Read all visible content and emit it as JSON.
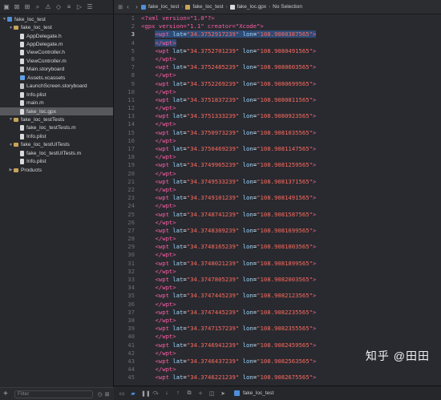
{
  "colors": {
    "accent": "#4a90e2",
    "selection": "#2e4b76",
    "tag": "#fc5fa3",
    "attr": "#9ddbff",
    "string": "#fc6a5d"
  },
  "navigator": {
    "items": [
      {
        "label": "fake_loc_test",
        "level": 0,
        "kind": "project",
        "disclosure": "▼",
        "selected": false
      },
      {
        "label": "fake_loc_test",
        "level": 1,
        "kind": "folder",
        "disclosure": "▼",
        "selected": false
      },
      {
        "label": "AppDelegate.h",
        "level": 2,
        "kind": "file",
        "disclosure": "",
        "selected": false
      },
      {
        "label": "AppDelegate.m",
        "level": 2,
        "kind": "file",
        "disclosure": "",
        "selected": false
      },
      {
        "label": "ViewController.h",
        "level": 2,
        "kind": "file",
        "disclosure": "",
        "selected": false
      },
      {
        "label": "ViewController.m",
        "level": 2,
        "kind": "file",
        "disclosure": "",
        "selected": false
      },
      {
        "label": "Main.storyboard",
        "level": 2,
        "kind": "storyboard",
        "disclosure": "",
        "selected": false
      },
      {
        "label": "Assets.xcassets",
        "level": 2,
        "kind": "asset",
        "disclosure": "",
        "selected": false
      },
      {
        "label": "LaunchScreen.storyboard",
        "level": 2,
        "kind": "storyboard",
        "disclosure": "",
        "selected": false
      },
      {
        "label": "Info.plist",
        "level": 2,
        "kind": "file",
        "disclosure": "",
        "selected": false
      },
      {
        "label": "main.m",
        "level": 2,
        "kind": "file",
        "disclosure": "",
        "selected": false
      },
      {
        "label": "fake_loc.gpx",
        "level": 2,
        "kind": "file",
        "disclosure": "",
        "selected": true
      },
      {
        "label": "fake_loc_testTests",
        "level": 1,
        "kind": "folder",
        "disclosure": "▼",
        "selected": false
      },
      {
        "label": "fake_loc_testTests.m",
        "level": 2,
        "kind": "file",
        "disclosure": "",
        "selected": false
      },
      {
        "label": "Info.plist",
        "level": 2,
        "kind": "file",
        "disclosure": "",
        "selected": false
      },
      {
        "label": "fake_loc_testUITests",
        "level": 1,
        "kind": "folder",
        "disclosure": "▼",
        "selected": false
      },
      {
        "label": "fake_loc_testUITests.m",
        "level": 2,
        "kind": "file",
        "disclosure": "",
        "selected": false
      },
      {
        "label": "Info.plist",
        "level": 2,
        "kind": "file",
        "disclosure": "",
        "selected": false
      },
      {
        "label": "Products",
        "level": 1,
        "kind": "folder",
        "disclosure": "▶",
        "selected": false
      }
    ],
    "filter_placeholder": "Filter",
    "add_label": "+"
  },
  "jump_bar": {
    "crumbs": [
      "fake_loc_test",
      "fake_loc_test",
      "fake_loc.gpx",
      "No Selection"
    ]
  },
  "editor": {
    "lines": [
      {
        "n": "1",
        "indent": "",
        "kind": "xmldecl",
        "text": "<?xml version=\"1.0\"?>",
        "highlight": false
      },
      {
        "n": "2",
        "indent": "",
        "kind": "gpx",
        "text": "<gpx version=\"1.1\" creator=\"Xcode\">",
        "highlight": false
      },
      {
        "n": "3",
        "indent": "    ",
        "kind": "wpt",
        "lat": "34.3752917239",
        "lon": "108.9080387565",
        "highlight": true
      },
      {
        "n": "4",
        "indent": "    ",
        "kind": "close",
        "text": "</wpt>",
        "highlight": true
      },
      {
        "n": "5",
        "indent": "    ",
        "kind": "wpt",
        "lat": "34.3752701239",
        "lon": "108.9080491565",
        "highlight": false
      },
      {
        "n": "6",
        "indent": "    ",
        "kind": "close",
        "text": "</wpt>",
        "highlight": false
      },
      {
        "n": "7",
        "indent": "    ",
        "kind": "wpt",
        "lat": "34.3752485239",
        "lon": "108.9080603565",
        "highlight": false
      },
      {
        "n": "8",
        "indent": "    ",
        "kind": "close",
        "text": "</wpt>",
        "highlight": false
      },
      {
        "n": "9",
        "indent": "    ",
        "kind": "wpt",
        "lat": "34.3752269239",
        "lon": "108.9080699565",
        "highlight": false
      },
      {
        "n": "10",
        "indent": "    ",
        "kind": "close",
        "text": "</wpt>",
        "highlight": false
      },
      {
        "n": "11",
        "indent": "    ",
        "kind": "wpt",
        "lat": "34.3751837239",
        "lon": "108.9080811565",
        "highlight": false
      },
      {
        "n": "12",
        "indent": "    ",
        "kind": "close",
        "text": "</wpt>",
        "highlight": false
      },
      {
        "n": "13",
        "indent": "    ",
        "kind": "wpt",
        "lat": "34.3751333239",
        "lon": "108.9080923565",
        "highlight": false
      },
      {
        "n": "14",
        "indent": "    ",
        "kind": "close",
        "text": "</wpt>",
        "highlight": false
      },
      {
        "n": "15",
        "indent": "    ",
        "kind": "wpt",
        "lat": "34.3750973239",
        "lon": "108.9081035565",
        "highlight": false
      },
      {
        "n": "16",
        "indent": "    ",
        "kind": "close",
        "text": "</wpt>",
        "highlight": false
      },
      {
        "n": "17",
        "indent": "    ",
        "kind": "wpt",
        "lat": "34.3750469239",
        "lon": "108.9081147565",
        "highlight": false
      },
      {
        "n": "18",
        "indent": "    ",
        "kind": "close",
        "text": "</wpt>",
        "highlight": false
      },
      {
        "n": "19",
        "indent": "    ",
        "kind": "wpt",
        "lat": "34.3749965239",
        "lon": "108.9081259565",
        "highlight": false
      },
      {
        "n": "20",
        "indent": "    ",
        "kind": "close",
        "text": "</wpt>",
        "highlight": false
      },
      {
        "n": "21",
        "indent": "    ",
        "kind": "wpt",
        "lat": "34.3749533239",
        "lon": "108.9081371565",
        "highlight": false
      },
      {
        "n": "22",
        "indent": "    ",
        "kind": "close",
        "text": "</wpt>",
        "highlight": false
      },
      {
        "n": "23",
        "indent": "    ",
        "kind": "wpt",
        "lat": "34.3749101239",
        "lon": "108.9081491565",
        "highlight": false
      },
      {
        "n": "24",
        "indent": "    ",
        "kind": "close",
        "text": "</wpt>",
        "highlight": false
      },
      {
        "n": "25",
        "indent": "    ",
        "kind": "wpt",
        "lat": "34.3748741239",
        "lon": "108.9081587565",
        "highlight": false
      },
      {
        "n": "26",
        "indent": "    ",
        "kind": "close",
        "text": "</wpt>",
        "highlight": false
      },
      {
        "n": "27",
        "indent": "    ",
        "kind": "wpt",
        "lat": "34.3748309239",
        "lon": "108.9081699565",
        "highlight": false
      },
      {
        "n": "28",
        "indent": "    ",
        "kind": "close",
        "text": "</wpt>",
        "highlight": false
      },
      {
        "n": "29",
        "indent": "    ",
        "kind": "wpt",
        "lat": "34.3748165239",
        "lon": "108.9081803565",
        "highlight": false
      },
      {
        "n": "30",
        "indent": "    ",
        "kind": "close",
        "text": "</wpt>",
        "highlight": false
      },
      {
        "n": "31",
        "indent": "    ",
        "kind": "wpt",
        "lat": "34.3748021239",
        "lon": "108.9081899565",
        "highlight": false
      },
      {
        "n": "32",
        "indent": "    ",
        "kind": "close",
        "text": "</wpt>",
        "highlight": false
      },
      {
        "n": "33",
        "indent": "    ",
        "kind": "wpt",
        "lat": "34.3747805239",
        "lon": "108.9082003565",
        "highlight": false
      },
      {
        "n": "34",
        "indent": "    ",
        "kind": "close",
        "text": "</wpt>",
        "highlight": false
      },
      {
        "n": "35",
        "indent": "    ",
        "kind": "wpt",
        "lat": "34.3747445239",
        "lon": "108.9082123565",
        "highlight": false
      },
      {
        "n": "36",
        "indent": "    ",
        "kind": "close",
        "text": "</wpt>",
        "highlight": false
      },
      {
        "n": "37",
        "indent": "    ",
        "kind": "wpt",
        "lat": "34.3747445239",
        "lon": "108.9082235565",
        "highlight": false
      },
      {
        "n": "38",
        "indent": "    ",
        "kind": "close",
        "text": "</wpt>",
        "highlight": false
      },
      {
        "n": "39",
        "indent": "    ",
        "kind": "wpt",
        "lat": "34.3747157239",
        "lon": "108.9082355565",
        "highlight": false
      },
      {
        "n": "40",
        "indent": "    ",
        "kind": "close",
        "text": "</wpt>",
        "highlight": false
      },
      {
        "n": "41",
        "indent": "    ",
        "kind": "wpt",
        "lat": "34.3746941239",
        "lon": "108.9082459565",
        "highlight": false
      },
      {
        "n": "42",
        "indent": "    ",
        "kind": "close",
        "text": "</wpt>",
        "highlight": false
      },
      {
        "n": "43",
        "indent": "    ",
        "kind": "wpt",
        "lat": "34.3746437239",
        "lon": "108.9082563565",
        "highlight": false
      },
      {
        "n": "44",
        "indent": "    ",
        "kind": "close",
        "text": "</wpt>",
        "highlight": false
      },
      {
        "n": "45",
        "indent": "    ",
        "kind": "wpt",
        "lat": "34.3746221239",
        "lon": "108.9082675565",
        "highlight": false
      }
    ]
  },
  "status_bar": {
    "target_label": "fake_loc_test"
  },
  "watermark": "知乎 @田田"
}
